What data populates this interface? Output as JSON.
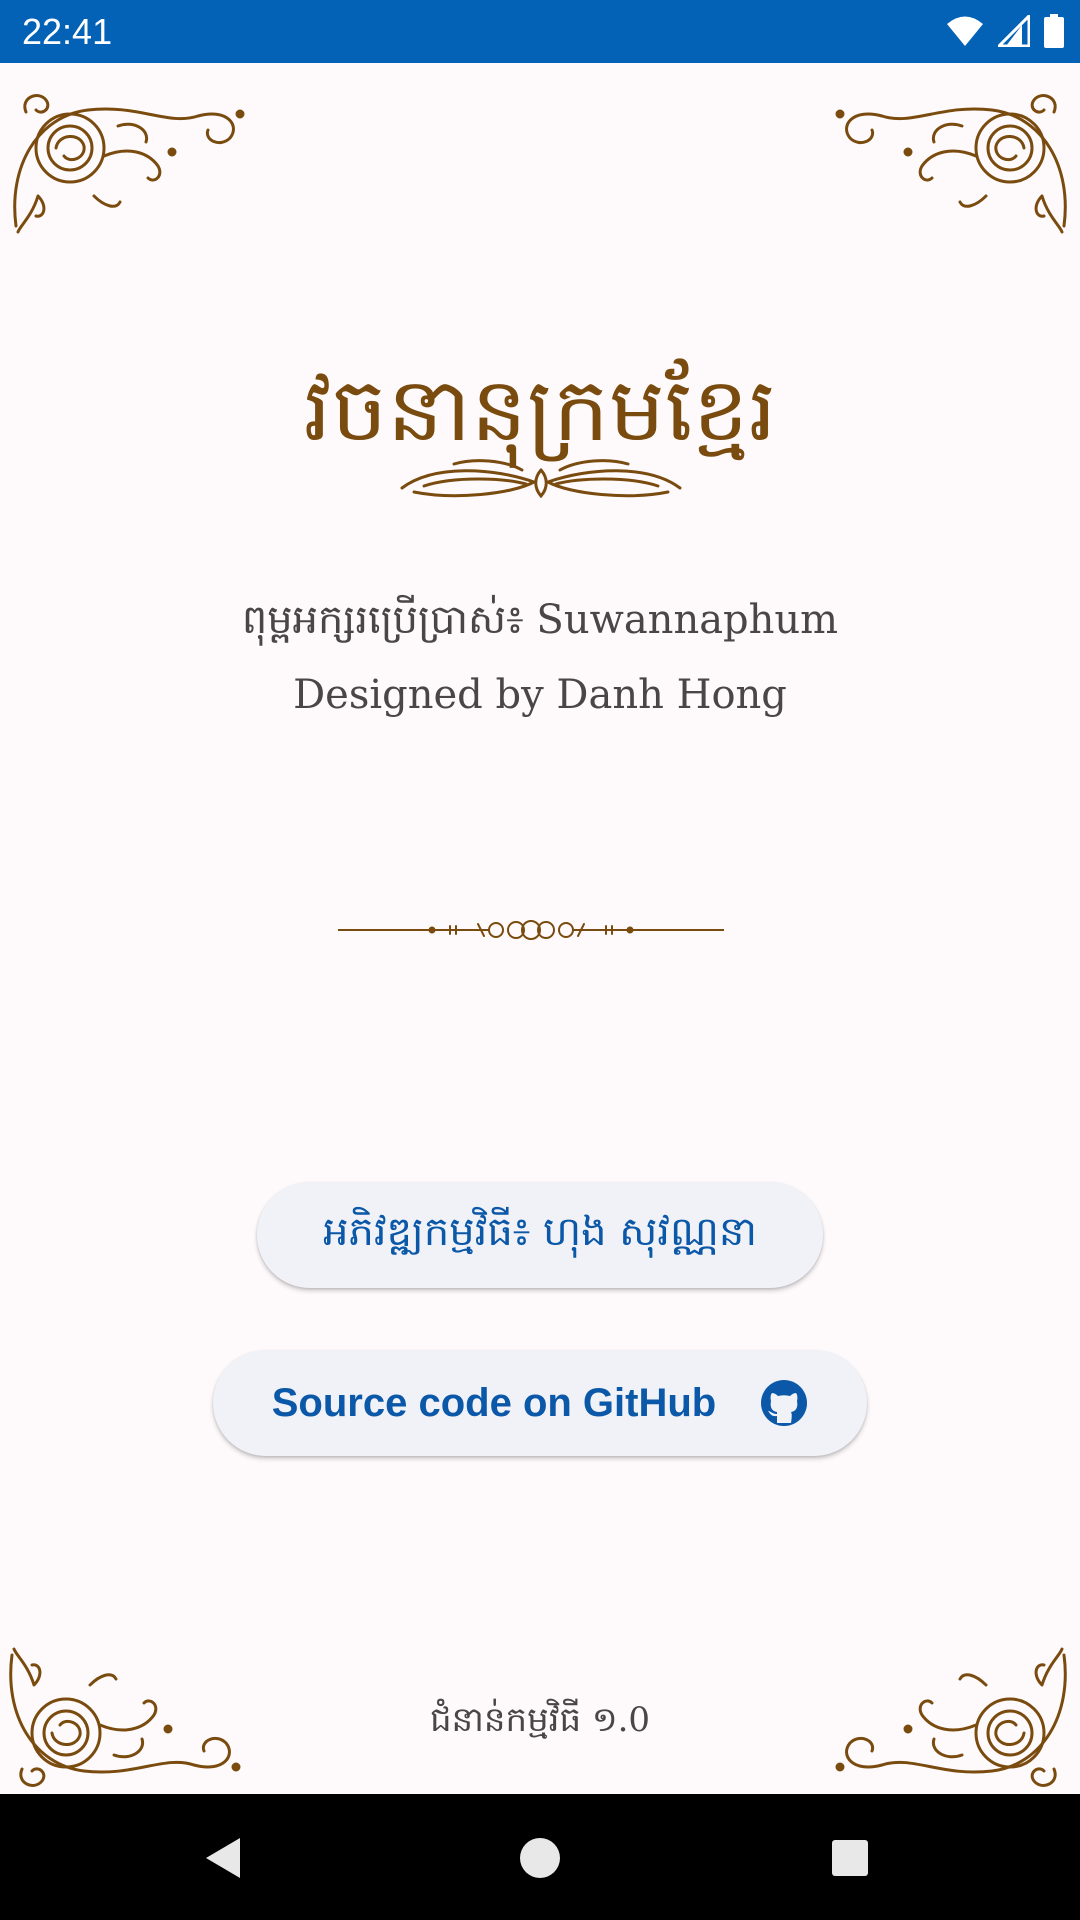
{
  "status_bar": {
    "time": "22:41",
    "icons": [
      "wifi-icon",
      "cell-signal-icon",
      "battery-icon"
    ],
    "background": "#0462b6"
  },
  "app": {
    "title": "វចនានុក្រមខ្មែរ",
    "font_credit": "ពុម្ពអក្សរប្រើប្រាស់៖ Suwannaphum",
    "designer_credit": "Designed by Danh Hong",
    "developer_button": "អភិវឌ្ឍកម្មវិធី៖ ហុង សុវណ្ណនា",
    "github_button": "Source code on GitHub",
    "version": "ជំនាន់កម្មវិធី ១.0"
  },
  "colors": {
    "ornament": "#7a4b0e",
    "button_text": "#0b57a8",
    "button_bg": "#f0f2f7",
    "page_bg": "#fefafc"
  },
  "nav_bar": {
    "buttons": [
      "back-icon",
      "home-icon",
      "recents-icon"
    ]
  }
}
